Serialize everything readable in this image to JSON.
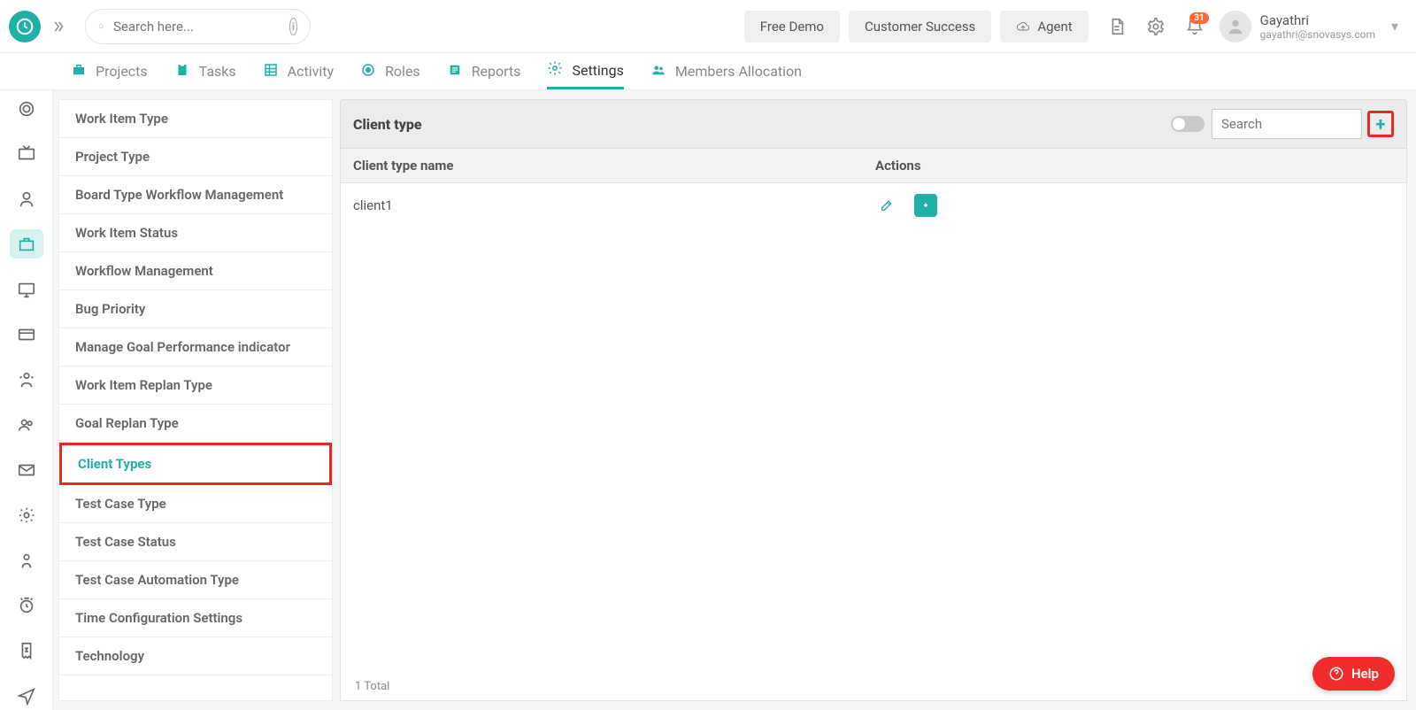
{
  "topbar": {
    "search_placeholder": "Search here...",
    "buttons": {
      "free_demo": "Free Demo",
      "customer_success": "Customer Success",
      "agent": "Agent"
    },
    "notification_count": "31",
    "user": {
      "name": "Gayathri",
      "email": "gayathri@snovasys.com"
    }
  },
  "tabs": [
    {
      "label": "Projects"
    },
    {
      "label": "Tasks"
    },
    {
      "label": "Activity"
    },
    {
      "label": "Roles"
    },
    {
      "label": "Reports"
    },
    {
      "label": "Settings"
    },
    {
      "label": "Members Allocation"
    }
  ],
  "side_items": [
    "Work Item Type",
    "Project Type",
    "Board Type Workflow Management",
    "Work Item Status",
    "Workflow Management",
    "Bug Priority",
    "Manage Goal Performance indicator",
    "Work Item Replan Type",
    "Goal Replan Type",
    "Client Types",
    "Test Case Type",
    "Test Case Status",
    "Test Case Automation Type",
    "Time Configuration Settings",
    "Technology"
  ],
  "panel": {
    "title": "Client type",
    "search_placeholder": "Search",
    "columns": {
      "name": "Client type name",
      "actions": "Actions"
    },
    "rows": [
      {
        "name": "client1"
      }
    ],
    "total_label": "1 Total"
  },
  "help_label": "Help"
}
